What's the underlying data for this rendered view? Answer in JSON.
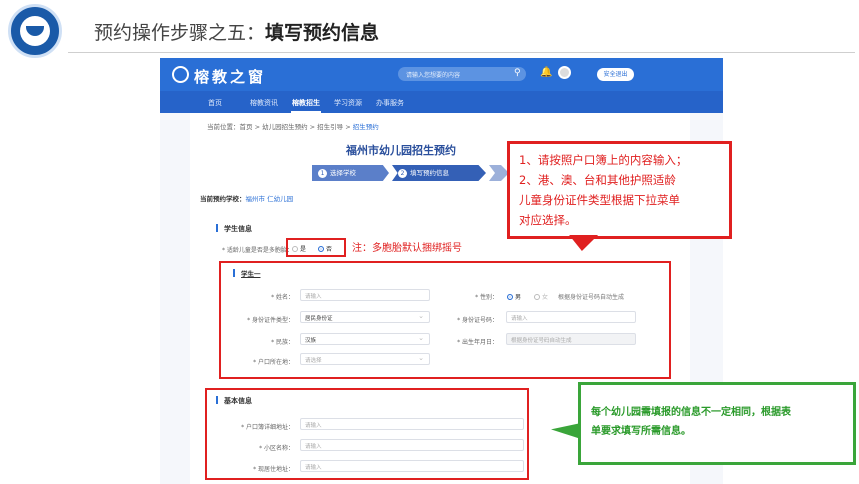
{
  "slide": {
    "title_prefix": "预约操作步骤之五：",
    "title_bold": "填写预约信息"
  },
  "header": {
    "brand": "榕教之窗",
    "search_placeholder": "请输入您想要的内容",
    "logout": "安全退出"
  },
  "nav": {
    "items": [
      "首页",
      "榕教资讯",
      "榕教招生",
      "学习资源",
      "办事服务"
    ],
    "active": "榕教招生"
  },
  "breadcrumb": {
    "prefix": "当前位置：",
    "path": "首页 > 幼儿园招生预约 > 招生引导 > ",
    "current": "招生预约"
  },
  "page": {
    "title": "福州市幼儿园招生预约",
    "steps": [
      {
        "num": "1",
        "label": "选择学校"
      },
      {
        "num": "2",
        "label": "填写预约信息"
      },
      {
        "num": "3",
        "label": ""
      }
    ],
    "school_label": "当前预约学校：",
    "school_value": "福州市        仁幼儿园"
  },
  "student_section": {
    "title": "学生信息",
    "multi_birth_label": "* 适龄儿童是否是多胞胎：",
    "multi_birth_yes": "是",
    "multi_birth_no": "否",
    "student_tab": "学生一",
    "fields": {
      "name_label": "* 姓名：",
      "name_placeholder": "请输入",
      "gender_label": "* 性别：",
      "gender_male": "男",
      "gender_female": "女",
      "gender_hint": "根据身份证号码自动生成",
      "id_type_label": "* 身份证件类型：",
      "id_type_value": "居民身份证",
      "id_no_label": "* 身份证号码：",
      "id_no_placeholder": "请输入",
      "ethnic_label": "* 民族：",
      "ethnic_value": "汉族",
      "birth_label": "* 出生年月日：",
      "birth_placeholder": "根据身份证号码自动生成",
      "hukou_label": "* 户口所在地：",
      "hukou_placeholder": "请选择"
    }
  },
  "basic_section": {
    "title": "基本信息",
    "hukou_addr_label": "* 户口簿详细地址：",
    "community_label": "* 小区名称：",
    "residence_label": "* 现居住地址：",
    "placeholder": "请输入"
  },
  "annotations": {
    "note": "注：多胞胎默认捆绑摇号",
    "red_callout": [
      "1、请按照户口簿上的内容输入；",
      "2、港、澳、台和其他护照适龄",
      "儿童身份证件类型根据下拉菜单",
      "对应选择。"
    ],
    "green_callout": [
      "每个幼儿园需填报的信息不一定相同，根据表",
      "单要求填写所需信息。"
    ],
    "colors": {
      "red": "#e02020",
      "green": "#3aa53a",
      "blue": "#2a6fd6"
    }
  }
}
